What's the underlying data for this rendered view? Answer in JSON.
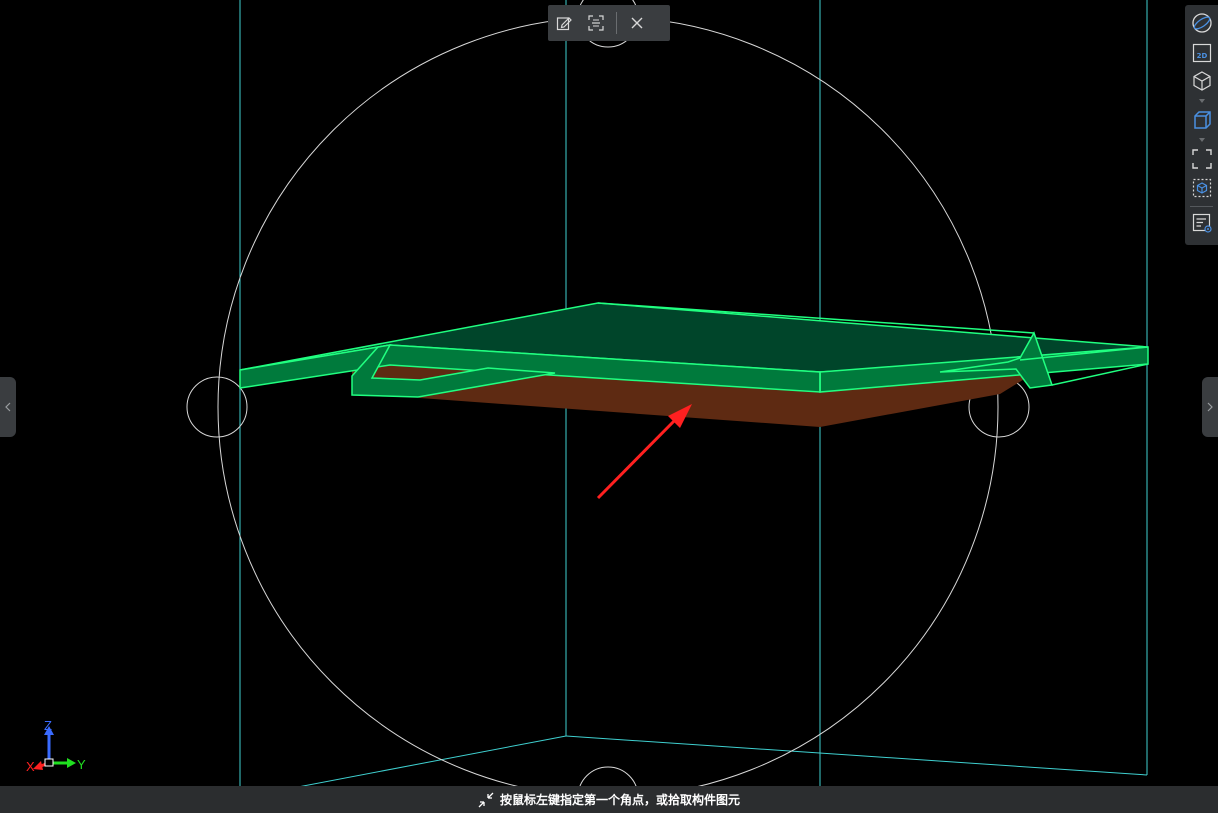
{
  "top_toolbar": {
    "buttons": [
      {
        "icon": "edit-icon"
      },
      {
        "icon": "scan-select-icon"
      },
      {
        "icon": "close-icon"
      }
    ]
  },
  "view_toolbar": {
    "buttons": [
      {
        "icon": "orbit-sphere-icon"
      },
      {
        "icon": "view-2d-icon",
        "label": "2D"
      },
      {
        "icon": "view-3d-cube-icon"
      },
      {
        "icon": "solid-cube-icon"
      },
      {
        "icon": "fit-view-icon"
      },
      {
        "icon": "box-select-icon"
      },
      {
        "icon": "display-settings-icon"
      }
    ],
    "accent_color": "#4a90e2"
  },
  "side_tabs": {
    "left_icon": "chevron-left-icon",
    "right_icon": "chevron-right-icon"
  },
  "status_bar": {
    "icon": "shrink-arrows-icon",
    "message": "按鼠标左键指定第一个角点，或拾取构件图元"
  },
  "axis_gizmo": {
    "z_label": "Z",
    "x_label": "X",
    "y_label": "Y",
    "colors": {
      "z": "#3a6bff",
      "x": "#ff2020",
      "y": "#20e020"
    }
  },
  "scene_colors": {
    "background": "#000000",
    "bounding_box": "#3fd0d0",
    "orbit_circle": "#d8d8d8",
    "slab_fill": "#00452a",
    "edge": "#20ff80",
    "side_fill": "#007a3c",
    "bottom_plate": "#5e2a12",
    "arrow": "#ff2020"
  }
}
